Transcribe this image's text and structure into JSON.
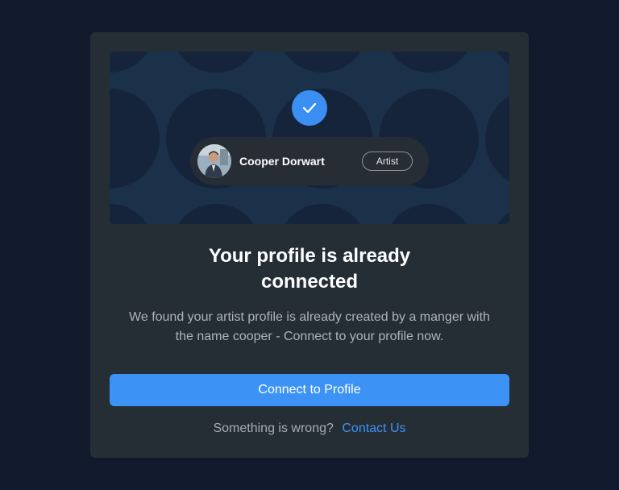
{
  "banner": {
    "check_icon": "check-icon",
    "profile": {
      "name": "Cooper Dorwart",
      "badge": "Artist",
      "avatar_icon": "user-avatar"
    }
  },
  "heading": {
    "line1": "Your profile is already",
    "line2": "connected"
  },
  "description": {
    "line1": "We found your artist profile is already created by a manger with",
    "line2": "the name cooper - Connect to your profile now."
  },
  "primary_button": {
    "label": "Connect to Profile"
  },
  "footer": {
    "prompt": "Something is wrong?",
    "link_label": "Contact Us"
  },
  "colors": {
    "page_background": "#111a2c",
    "card": "#252d35",
    "accent": "#3d93f5",
    "banner": "#1b3049"
  }
}
